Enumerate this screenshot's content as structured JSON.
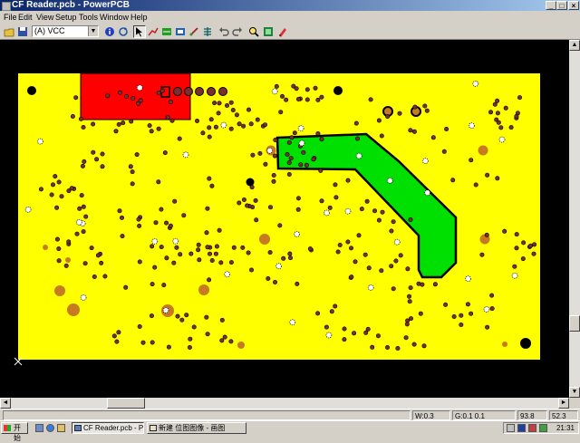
{
  "window": {
    "title": "CF Reader.pcb - PowerPCB"
  },
  "menu": [
    "File",
    "Edit",
    "View",
    "Setup",
    "Tools",
    "Window",
    "Help"
  ],
  "toolbar": {
    "layer_select": "(A) VCC",
    "dropdown_arrow": "▼"
  },
  "status": {
    "width": "W:0.3",
    "grid": "G:0.1 0.1",
    "x": "93.8",
    "y": "52.3"
  },
  "taskbar": {
    "start": "开始",
    "tasks": [
      "CF Reader.pcb - P...",
      "新建 位图图像 - 画图"
    ],
    "clock": "21:31"
  },
  "colors": {
    "board": "#ffff00",
    "background": "#000000",
    "copper_pour_red": "#ff0000",
    "copper_pour_green": "#00e000",
    "via": "#7a2e2e",
    "pad_orange": "#c87a20",
    "titlebar_start": "#0a246a",
    "titlebar_end": "#a6caf0"
  },
  "icons": {
    "toolbar": [
      "open-folder-icon",
      "save-icon",
      "info-icon",
      "refresh-icon",
      "select-arrow-icon",
      "route-icon",
      "drc-icon",
      "layer-icon",
      "report-icon",
      "netlist-icon",
      "undo-icon",
      "redo-icon",
      "zoom-icon",
      "pour-icon",
      "highlight-icon"
    ]
  }
}
